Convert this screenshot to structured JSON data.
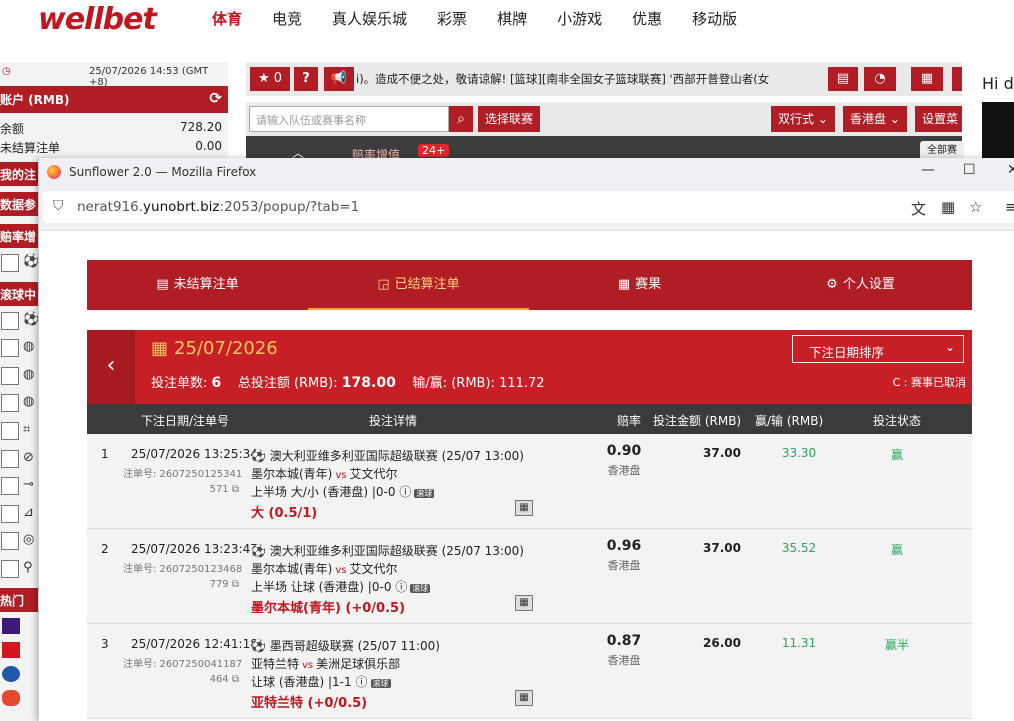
{
  "site": {
    "logo": "wellbet",
    "nav": [
      "体育",
      "电竞",
      "真人娱乐城",
      "彩票",
      "棋牌",
      "小游戏",
      "优惠",
      "移动版"
    ]
  },
  "sidebar": {
    "datetime": "25/07/2026 14:53 (GMT +8)",
    "account_title": "账户 (RMB)",
    "balance_label": "余额",
    "balance_value": "728.20",
    "unsettled_label": "未结算注单",
    "unsettled_value": "0.00",
    "sections": [
      "我的注",
      "数据参",
      "赔率增",
      "滚球中",
      "热门"
    ]
  },
  "toolbar": {
    "fav_count": "0",
    "marquee": "i)。造成不便之处，敬请谅解!        [篮球][南非全国女子篮球联赛] '西部开普登山者(女",
    "search_placeholder": "请输入队伍或赛事名称",
    "select_league": "选择联赛",
    "odds_format": "双行式",
    "market": "香港盘",
    "settings": "设置菜",
    "odds_boost": "赔率增值",
    "odds_boost_badge": "24+",
    "all_label": "全部赛",
    "hi_text": "Hi d"
  },
  "browser": {
    "title": "Sunflower 2.0 — Mozilla Firefox",
    "url_prefix": "nerat916.",
    "url_host": "yunobrt.biz",
    "url_rest": ":2053/popup/?tab=1"
  },
  "popup": {
    "tabs": [
      "未结算注单",
      "已结算注单",
      "赛果",
      "个人设置"
    ],
    "date": "25/07/2026",
    "bet_count_label": "投注单数:",
    "bet_count": "6",
    "total_label": "总投注额 (RMB):",
    "total": "178.00",
    "winloss_label": "输/赢: (RMB):",
    "winloss": "111.72",
    "sort": "下注日期排序",
    "note": "C : 赛事已取消",
    "columns": [
      "下注日期/注单号",
      "投注详情",
      "赔率",
      "投注金额 (RMB)",
      "赢/输 (RMB)",
      "投注状态"
    ],
    "bets": [
      {
        "idx": "1",
        "datetime": "25/07/2026 13:25:34",
        "ticket": "注单号: 2607250125341",
        "copy": "571",
        "league": "澳大利亚维多利亚国际超级联赛 (25/07 13:00)",
        "home": "墨尔本城(青年)",
        "vs": "vs",
        "away": "艾文代尔",
        "market": "上半场 大/小 (香港盘) |",
        "score": "0-0",
        "live": "滚球",
        "pick": "大 (0.5/1)",
        "odds": "0.90",
        "odds_type": "香港盘",
        "stake": "37.00",
        "result": "33.30",
        "status": "赢"
      },
      {
        "idx": "2",
        "datetime": "25/07/2026 13:23:47",
        "ticket": "注单号: 2607250123468",
        "copy": "779",
        "league": "澳大利亚维多利亚国际超级联赛 (25/07 13:00)",
        "home": "墨尔本城(青年)",
        "vs": "vs",
        "away": "艾文代尔",
        "market": "上半场 让球 (香港盘) |",
        "score": "0-0",
        "live": "滚球",
        "pick": "墨尔本城(青年) (+0/0.5)",
        "odds": "0.96",
        "odds_type": "香港盘",
        "stake": "37.00",
        "result": "35.52",
        "status": "赢"
      },
      {
        "idx": "3",
        "datetime": "25/07/2026 12:41:18",
        "ticket": "注单号: 2607250041187",
        "copy": "464",
        "league": "墨西哥超级联赛 (25/07 11:00)",
        "home": "亚特兰特",
        "vs": "vs",
        "away": "美洲足球俱乐部",
        "market": "让球 (香港盘) |",
        "score": "1-1",
        "live": "滚球",
        "pick": "亚特兰特 (+0/0.5)",
        "odds": "0.87",
        "odds_type": "香港盘",
        "stake": "26.00",
        "result": "11.31",
        "status": "赢半"
      }
    ]
  }
}
